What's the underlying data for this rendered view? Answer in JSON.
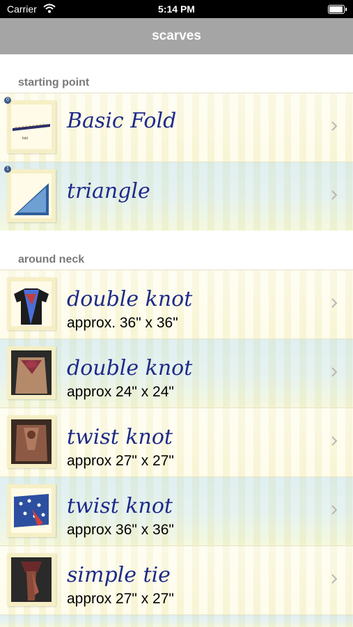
{
  "status_bar": {
    "carrier": "Carrier",
    "time": "5:14 PM"
  },
  "nav": {
    "title": "scarves"
  },
  "sections": [
    {
      "header": "starting point",
      "rows": [
        {
          "badge": "0",
          "title": "Basic Fold",
          "subtitle": ""
        },
        {
          "badge": "1",
          "title": "triangle",
          "subtitle": ""
        }
      ]
    },
    {
      "header": "around neck",
      "rows": [
        {
          "title": "double knot",
          "subtitle": "approx. 36\" x 36\""
        },
        {
          "title": "double knot",
          "subtitle": "approx 24\" x 24\""
        },
        {
          "title": "twist knot",
          "subtitle": "approx 27\" x 27\""
        },
        {
          "title": "twist knot",
          "subtitle": "approx 36\" x 36\""
        },
        {
          "title": "simple tie",
          "subtitle": "approx 27\" x 27\""
        }
      ]
    }
  ],
  "icons": {
    "wifi": "wifi-icon",
    "battery": "battery-icon",
    "chevron": "chevron-right-icon"
  },
  "colors": {
    "nav_bar": "#a5a5a5",
    "title_text": "#1e2a8a",
    "section_header": "#7a7a7a"
  }
}
